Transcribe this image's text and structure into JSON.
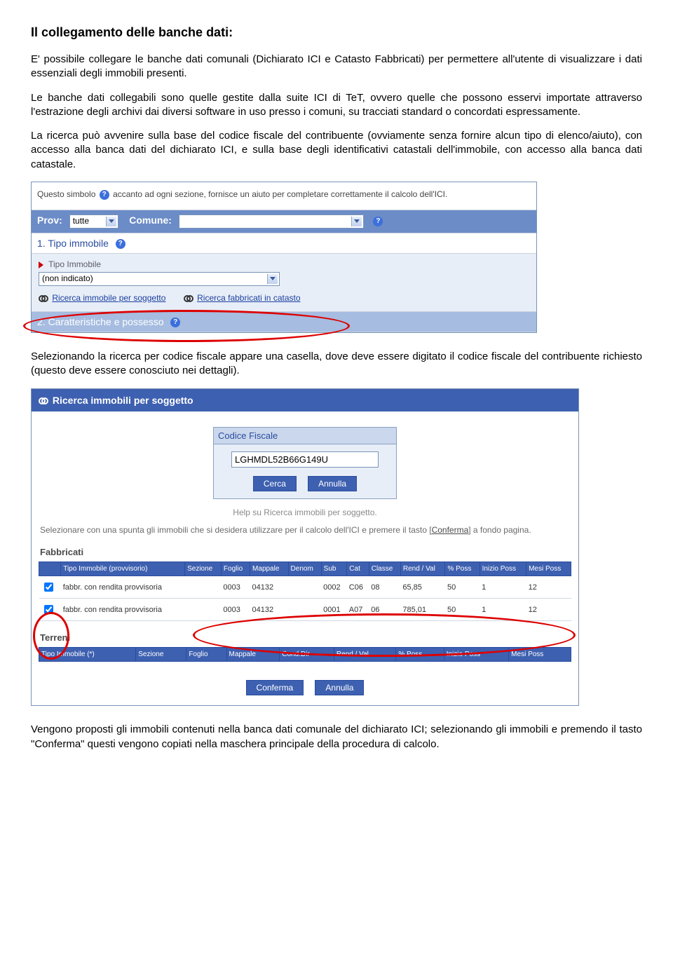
{
  "title": "Il collegamento delle banche dati:",
  "para1": "E' possibile collegare le banche dati comunali (Dichiarato ICI e Catasto Fabbricati) per permettere all'utente di visualizzare i dati essenziali degli immobili presenti.",
  "para2": "Le banche dati collegabili sono quelle gestite dalla suite ICI di TeT, ovvero quelle che possono esservi importate attraverso l'estrazione degli archivi dai diversi software in uso presso i comuni, su tracciati standard o concordati espressamente.",
  "para3": "La ricerca può avvenire sulla base del codice fiscale del contribuente (ovviamente senza fornire alcun tipo di elenco/aiuto), con accesso alla banca dati del dichiarato ICI, e sulla base degli identificativi catastali dell'immobile, con accesso alla banca dati catastale.",
  "shot1": {
    "info_pre": "Questo simbolo",
    "info_post": "accanto ad ogni sezione, fornisce un aiuto per completare correttamente il calcolo dell'ICI.",
    "prov_label": "Prov:",
    "prov_value": "tutte",
    "comune_label": "Comune:",
    "row1": "1. Tipo immobile",
    "tipo_label": "Tipo Immobile",
    "tipo_value": "(non indicato)",
    "link1": "Ricerca immobile per soggetto",
    "link2": "Ricerca fabbricati in catasto",
    "row2": "2. Caratteristiche e possesso"
  },
  "para4": "Selezionando la ricerca per codice fiscale appare una casella, dove deve essere digitato il codice fiscale del contribuente richiesto (questo deve essere conosciuto nei dettagli).",
  "shot2": {
    "title": "Ricerca immobili per soggetto",
    "cf_label": "Codice Fiscale",
    "cf_value": "LGHMDL52B66G149U",
    "btn_search": "Cerca",
    "btn_cancel": "Annulla",
    "help_line": "Help su Ricerca immobili per soggetto.",
    "instr_a": "Selezionare con una spunta gli immobili che si desidera utilizzare per il calcolo dell'ICI e premere il tasto [",
    "instr_link": "Conferma",
    "instr_b": "] a fondo pagina.",
    "fabbricati_label": "Fabbricati",
    "fab_headers": [
      "",
      "Tipo Immobile (provvisorio)",
      "Sezione",
      "Foglio",
      "Mappale",
      "Denom",
      "Sub",
      "Cat",
      "Classe",
      "Rend / Val",
      "% Poss",
      "Inizio Poss",
      "Mesi Poss"
    ],
    "fab_rows": [
      {
        "chk": true,
        "tipo": "fabbr. con rendita provvisoria",
        "sezione": "",
        "foglio": "0003",
        "mappale": "04132",
        "denom": "",
        "sub": "0002",
        "cat": "C06",
        "classe": "08",
        "rend": "65,85",
        "pposs": "50",
        "inizio": "1",
        "mesi": "12"
      },
      {
        "chk": true,
        "tipo": "fabbr. con rendita provvisoria",
        "sezione": "",
        "foglio": "0003",
        "mappale": "04132",
        "denom": "",
        "sub": "0001",
        "cat": "A07",
        "classe": "06",
        "rend": "785,01",
        "pposs": "50",
        "inizio": "1",
        "mesi": "12"
      }
    ],
    "terreni_label": "Terreni",
    "ter_headers": [
      "Tipo Immobile (*)",
      "Sezione",
      "Foglio",
      "Mappale",
      "Cond.Dir",
      "Rend / Val",
      "% Poss",
      "Inizio Poss",
      "Mesi Poss"
    ],
    "btn_confirm": "Conferma",
    "btn_cancel2": "Annulla"
  },
  "para5": "Vengono proposti gli immobili contenuti nella banca dati comunale del dichiarato ICI; selezionando gli immobili e premendo il tasto \"Conferma\" questi vengono copiati nella maschera principale della procedura di calcolo."
}
